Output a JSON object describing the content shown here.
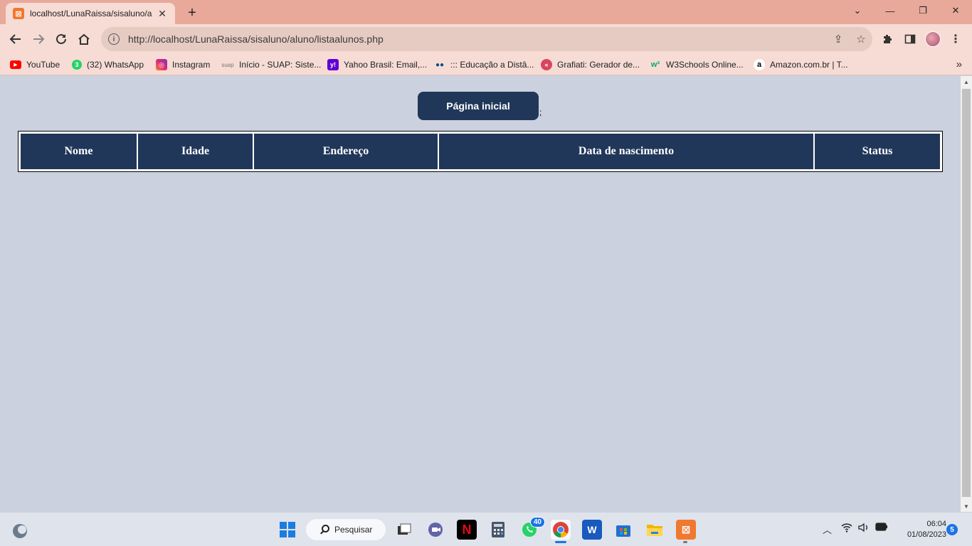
{
  "browser": {
    "tab": {
      "title": "localhost/LunaRaissa/sisaluno/alu",
      "favicon": "xampp-icon"
    },
    "url": "http://localhost/LunaRaissa/sisaluno/aluno/listaalunos.php",
    "bookmarks": [
      {
        "label": "YouTube",
        "icon": "youtube-icon",
        "color": "#ff0000",
        "glyph": "▶"
      },
      {
        "label": "(32) WhatsApp",
        "icon": "whatsapp-icon",
        "color": "#25d366",
        "glyph": "3"
      },
      {
        "label": "Instagram",
        "icon": "instagram-icon",
        "color": "#d6249f",
        "glyph": "◎"
      },
      {
        "label": "Início - SUAP: Siste...",
        "icon": "suap-icon",
        "color": "#888888",
        "glyph": "suap"
      },
      {
        "label": "Yahoo Brasil: Email,...",
        "icon": "yahoo-icon",
        "color": "#6001d2",
        "glyph": "y!"
      },
      {
        "label": "::: Educação a Distâ...",
        "icon": "ead-icon",
        "color": "#0d6efd",
        "glyph": "●●"
      },
      {
        "label": "Grafiati: Gerador de...",
        "icon": "grafiati-icon",
        "color": "#d9455f",
        "glyph": "«"
      },
      {
        "label": "W3Schools Online...",
        "icon": "w3schools-icon",
        "color": "#04aa6d",
        "glyph": "w³"
      },
      {
        "label": "Amazon.com.br | T...",
        "icon": "amazon-icon",
        "color": "#ffffff",
        "glyph": "a"
      }
    ]
  },
  "page": {
    "home_button": "Página inicial",
    "stray_text": ";",
    "table": {
      "headers": [
        "Nome",
        "Idade",
        "Endereço",
        "Data de nascimento",
        "Status"
      ]
    }
  },
  "taskbar": {
    "search_label": "Pesquisar",
    "whatsapp_badge": "40",
    "time": "06:04",
    "date": "01/08/2023",
    "notifications": "5"
  },
  "colors": {
    "accent": "#20375a",
    "page_background": "#cbd1de",
    "chrome_frame": "#e8a99a"
  }
}
